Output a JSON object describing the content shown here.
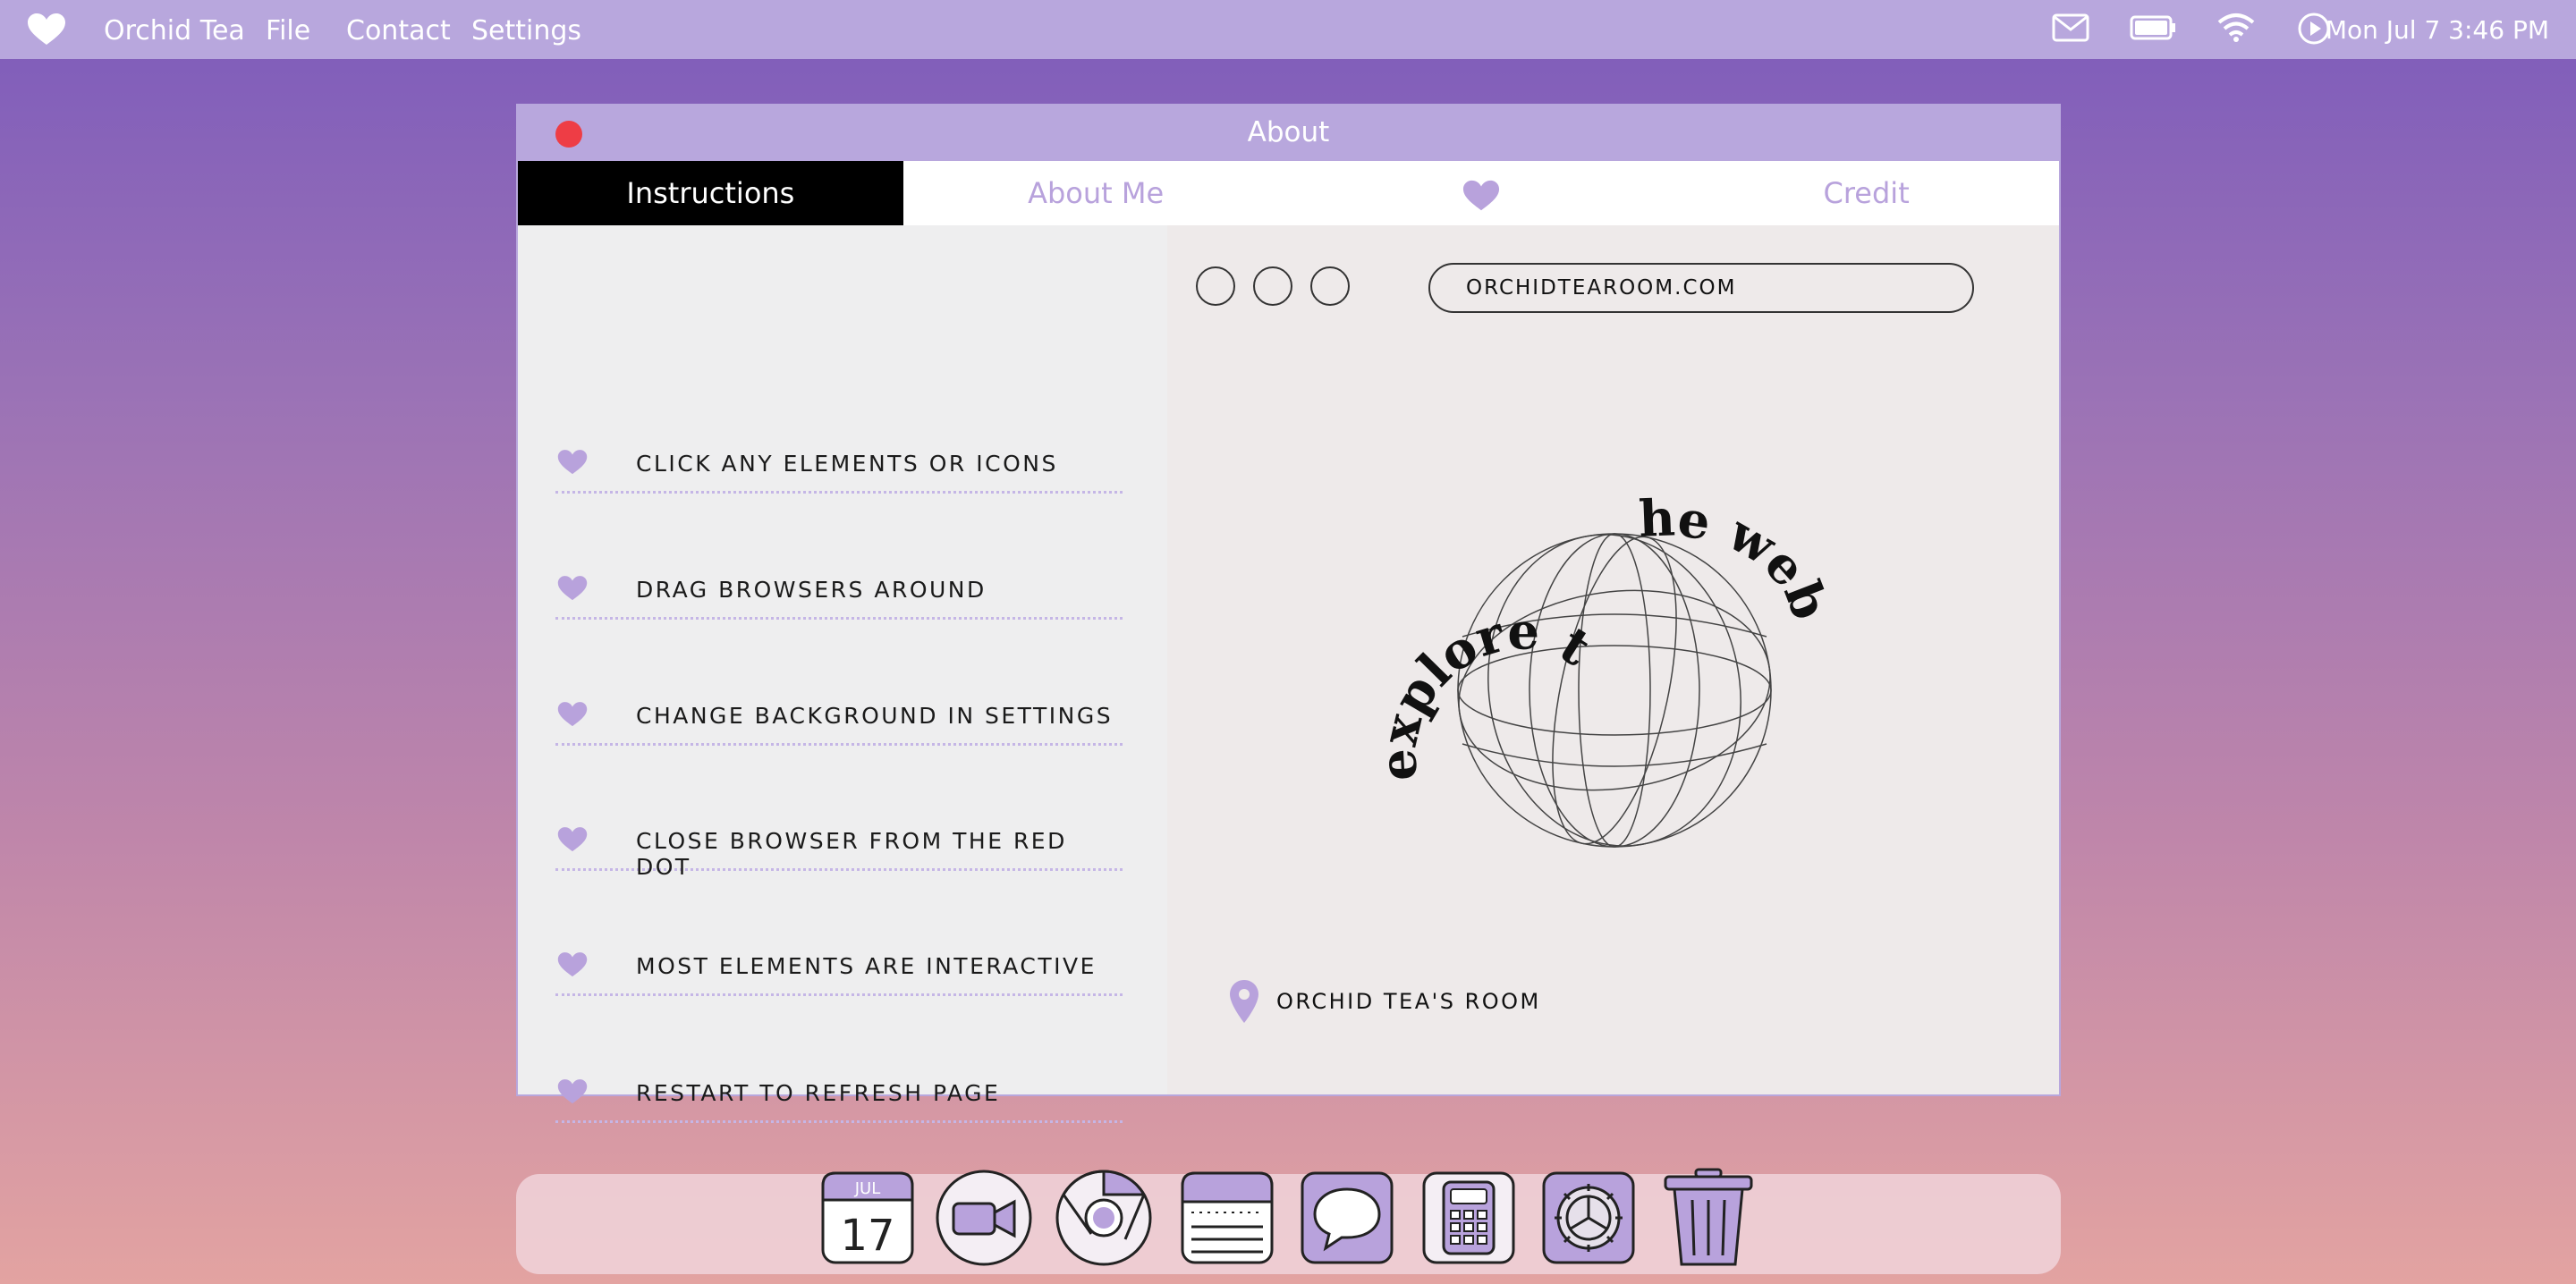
{
  "menubar": {
    "app_name": "Orchid Tea",
    "items": [
      "File",
      "Contact",
      "Settings"
    ],
    "clock": "Mon Jul 7  3:46 PM",
    "icons": [
      "heart-icon",
      "mail-icon",
      "battery-icon",
      "wifi-icon",
      "play-icon"
    ]
  },
  "window": {
    "title": "About",
    "tabs": [
      {
        "label": "Instructions",
        "active": true
      },
      {
        "label": "About Me",
        "active": false
      },
      {
        "label": "",
        "icon": "heart-icon",
        "active": false
      },
      {
        "label": "Credit",
        "active": false
      }
    ],
    "instructions": [
      "Click any elements or icons",
      "Drag browsers around",
      "Change background in settings",
      "Close browser from the red dot",
      "Most elements are interactive",
      "Restart to refresh page"
    ],
    "browser": {
      "url": "orchidtearoom.com",
      "art_text": "explore the web",
      "location": "Orchid Tea's Room"
    }
  },
  "dock": {
    "calendar_month": "JUL",
    "calendar_day": "17",
    "items": [
      "calendar-icon",
      "video-icon",
      "chrome-icon",
      "notes-icon",
      "messages-icon",
      "calculator-icon",
      "settings-icon",
      "trash-icon"
    ]
  },
  "colors": {
    "accent": "#b8a7dd",
    "close": "#ee3d45",
    "heart": "#b8a2dc"
  }
}
